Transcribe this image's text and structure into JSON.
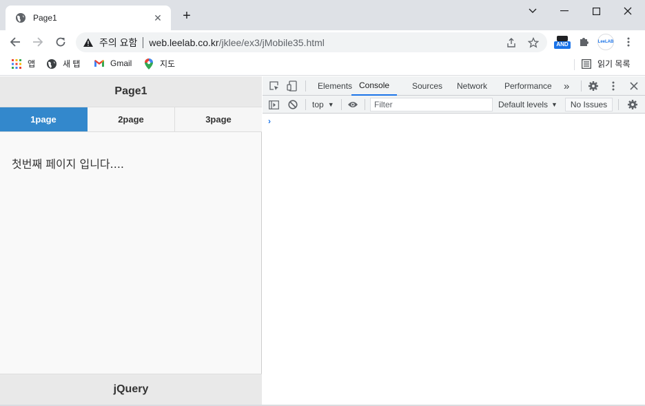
{
  "browser": {
    "tab": {
      "title": "Page1",
      "close_label": "✕"
    },
    "new_tab_label": "+",
    "window": {
      "minimize": "—",
      "maximize": "☐",
      "close": "✕",
      "menu": "⌄"
    },
    "omnibox": {
      "warning_text": "주의 요함",
      "url_host": "web.leelab.co.kr",
      "url_path": "/jklee/ex3/jMobile35.html"
    },
    "extension_badge": "AND",
    "profile_label": "LeeLAB",
    "bookmarks": [
      {
        "label": "앱",
        "icon": "apps-grid-icon"
      },
      {
        "label": "새 탭",
        "icon": "globe-icon"
      },
      {
        "label": "Gmail",
        "icon": "gmail-icon"
      },
      {
        "label": "지도",
        "icon": "maps-pin-icon"
      }
    ],
    "reading_list_label": "읽기 목록"
  },
  "page": {
    "header_title": "Page1",
    "navbar": [
      {
        "label": "1page",
        "active": true
      },
      {
        "label": "2page",
        "active": false
      },
      {
        "label": "3page",
        "active": false
      }
    ],
    "content_text": "첫번째 페이지 입니다....",
    "footer_title": "jQuery"
  },
  "devtools": {
    "tabs": [
      {
        "label": "Elements",
        "active": false
      },
      {
        "label": "Console",
        "active": true
      },
      {
        "label": "Sources",
        "active": false
      },
      {
        "label": "Network",
        "active": false
      },
      {
        "label": "Performance",
        "active": false
      }
    ],
    "more_tabs_label": "»",
    "context_label": "top",
    "filter_placeholder": "Filter",
    "levels_label": "Default levels",
    "issues_label": "No Issues",
    "prompt_symbol": "›"
  },
  "colors": {
    "active_nav": "#3388cc",
    "devtools_accent": "#1a73e8"
  }
}
